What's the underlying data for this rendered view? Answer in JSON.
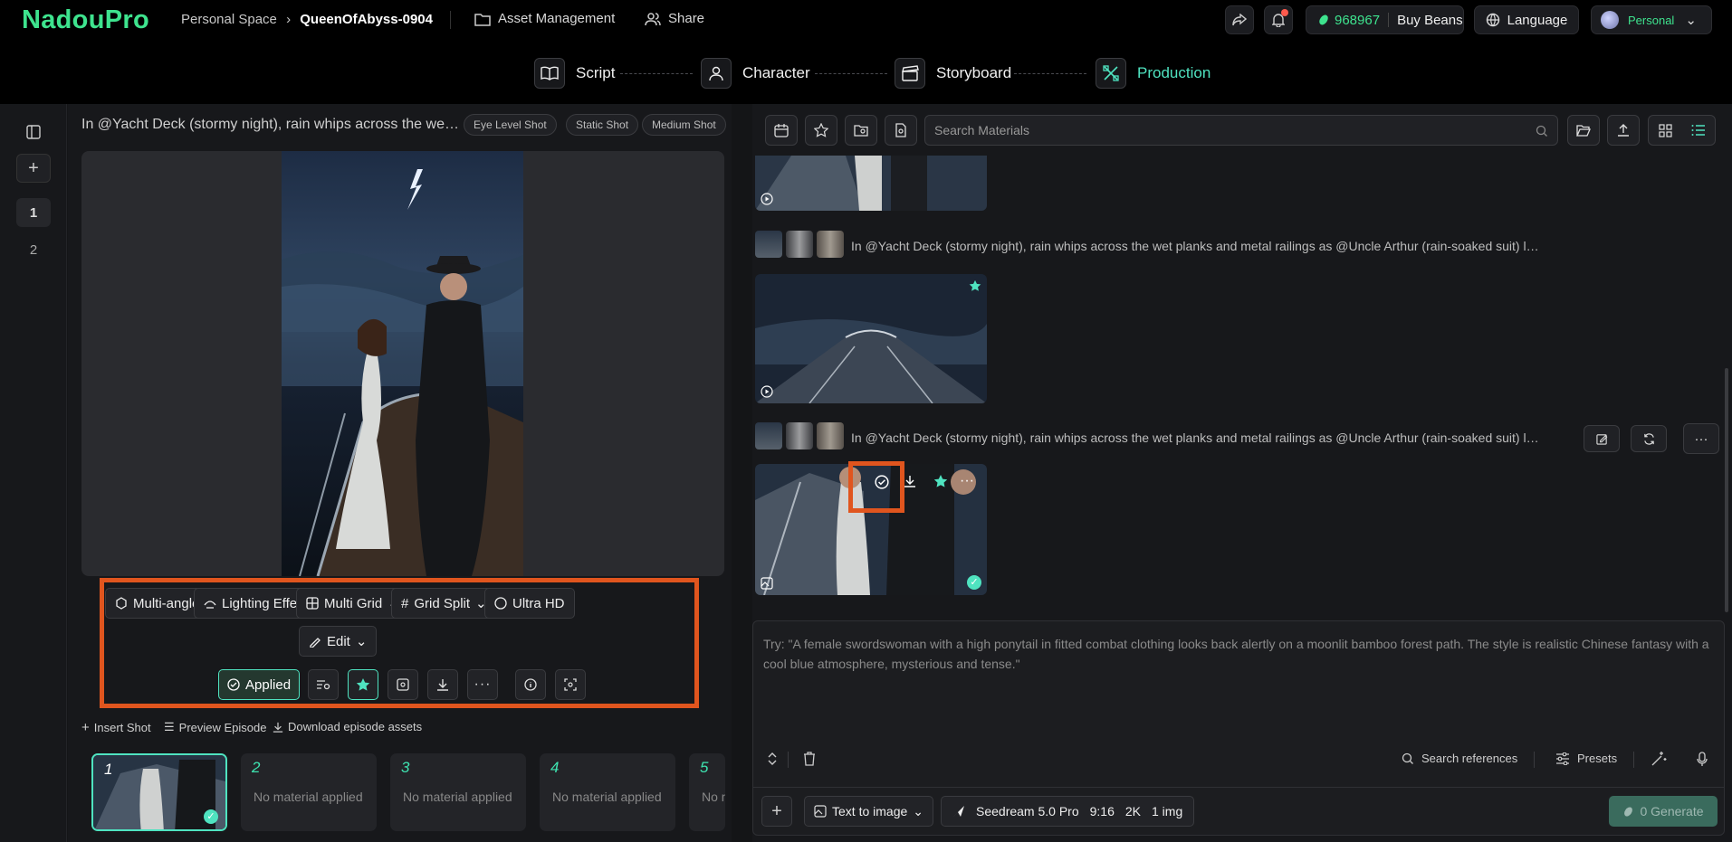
{
  "app": {
    "logo": "NadouPro"
  },
  "breadcrumb": {
    "space": "Personal Space",
    "project": "QueenOfAbyss-0904"
  },
  "topnav": {
    "asset_management": "Asset Management",
    "share": "Share"
  },
  "account": {
    "beans": "968967",
    "buy_beans": "Buy Beans",
    "language": "Language",
    "profile": "Personal"
  },
  "steps": [
    {
      "label": "Script"
    },
    {
      "label": "Character"
    },
    {
      "label": "Storyboard"
    },
    {
      "label": "Production"
    }
  ],
  "sidebar": {
    "shots": [
      "1",
      "2"
    ]
  },
  "shot": {
    "prompt": "In @Yacht Deck (stormy night), rain whips across the wet planks and metal railings as @Uncle Arthur (rain-soaked suit) looms over",
    "tags": [
      "Eye Level Shot",
      "Static Shot",
      "Medium Shot"
    ]
  },
  "tools": {
    "multi_angle": "Multi-angle",
    "lighting": "Lighting Effect",
    "multi_grid": "Multi Grid",
    "grid_split": "Grid Split",
    "ultra_hd": "Ultra HD",
    "edit": "Edit",
    "applied": "Applied"
  },
  "episode_actions": {
    "insert": "Insert Shot",
    "preview": "Preview Episode",
    "download": "Download episode assets"
  },
  "thumbs": [
    {
      "n": "1",
      "text": ""
    },
    {
      "n": "2",
      "text": "No material applied"
    },
    {
      "n": "3",
      "text": "No material applied"
    },
    {
      "n": "4",
      "text": "No material applied"
    },
    {
      "n": "5",
      "text": "No material applied"
    }
  ],
  "materials": {
    "search_placeholder": "Search Materials",
    "prompt_line_1": "In @Yacht Deck (stormy night), rain whips across the wet planks and metal railings as @Uncle Arthur (rain-soaked suit) looms over",
    "prompt_line_2": "In @Yacht Deck (stormy night), rain whips across the wet planks and metal railings as @Uncle Arthur (rain-soaked suit) looms over"
  },
  "composer": {
    "placeholder": "Try: \"A female swordswoman with a high ponytail in fitted combat clothing looks back alertly on a moonlit bamboo forest path. The style is realistic Chinese fantasy with a cool blue atmosphere, mysterious and tense.\"",
    "search_refs": "Search references",
    "presets": "Presets",
    "mode": "Text to image",
    "model": "Seedream 5.0 Pro",
    "ratio": "9:16",
    "res": "2K",
    "count": "1 img",
    "generate": "0 Generate"
  },
  "colors": {
    "accent": "#3ee38e",
    "teal": "#4fe3c0",
    "highlight": "#e0551e"
  }
}
